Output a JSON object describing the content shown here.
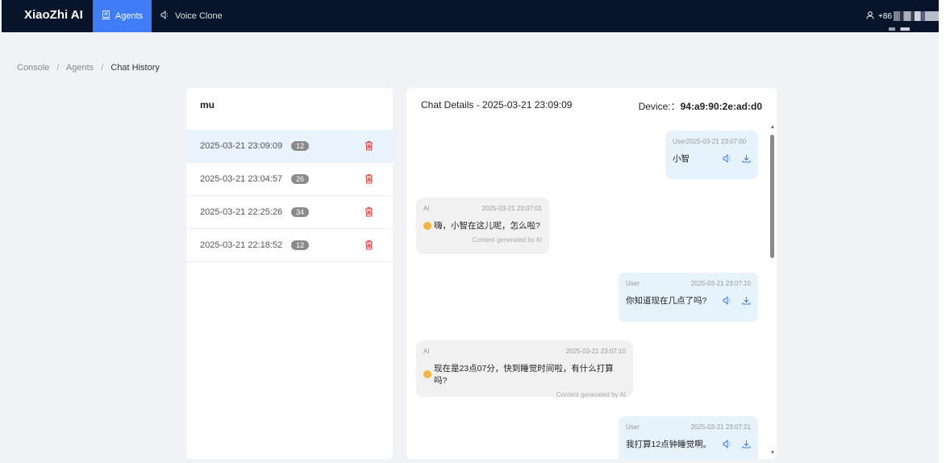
{
  "brand": "XiaoZhi AI",
  "nav": {
    "agents_label": "Agents",
    "voice_clone_label": "Voice Clone"
  },
  "user": {
    "phone_prefix": "+86"
  },
  "breadcrumb": {
    "items": [
      "Console",
      "Agents"
    ],
    "current": "Chat History"
  },
  "sessions_panel": {
    "title": "mu",
    "sessions": [
      {
        "time": "2025-03-21 23:09:09",
        "count": "12",
        "active": true
      },
      {
        "time": "2025-03-21 23:04:57",
        "count": "26",
        "active": false
      },
      {
        "time": "2025-03-21 22:25:26",
        "count": "34",
        "active": false
      },
      {
        "time": "2025-03-21 22:18:52",
        "count": "12",
        "active": false
      }
    ]
  },
  "chat": {
    "title": "Chat Details - 2025-03-21 23:09:09",
    "device_label": "Device:：",
    "device_id": "94:a9:90:2e:ad:d0",
    "ai_footer": "Content generated by AI",
    "messages": [
      {
        "role": "User",
        "header": "User2025-03-21 23:07:00",
        "text": "小智"
      },
      {
        "role": "AI",
        "time": "2025-03-21 23:07:01",
        "text": "嗨，小智在这儿呢，怎么啦?"
      },
      {
        "role": "User",
        "time": "2025-03-21 23:07:10",
        "text": "你知道现在几点了吗?"
      },
      {
        "role": "AI",
        "time": "2025-03-21 23:07:10",
        "text": "现在是23点07分，快到睡觉时间啦，有什么打算吗?"
      },
      {
        "role": "User",
        "time": "2025-03-21 23:07:21",
        "text": "我打算12点钟睡觉啊。"
      }
    ]
  },
  "colors": {
    "nav_bg": "#07142a",
    "accent": "#3f7cf6",
    "delete": "#e23b3b",
    "badge": "#8a8a8a"
  }
}
